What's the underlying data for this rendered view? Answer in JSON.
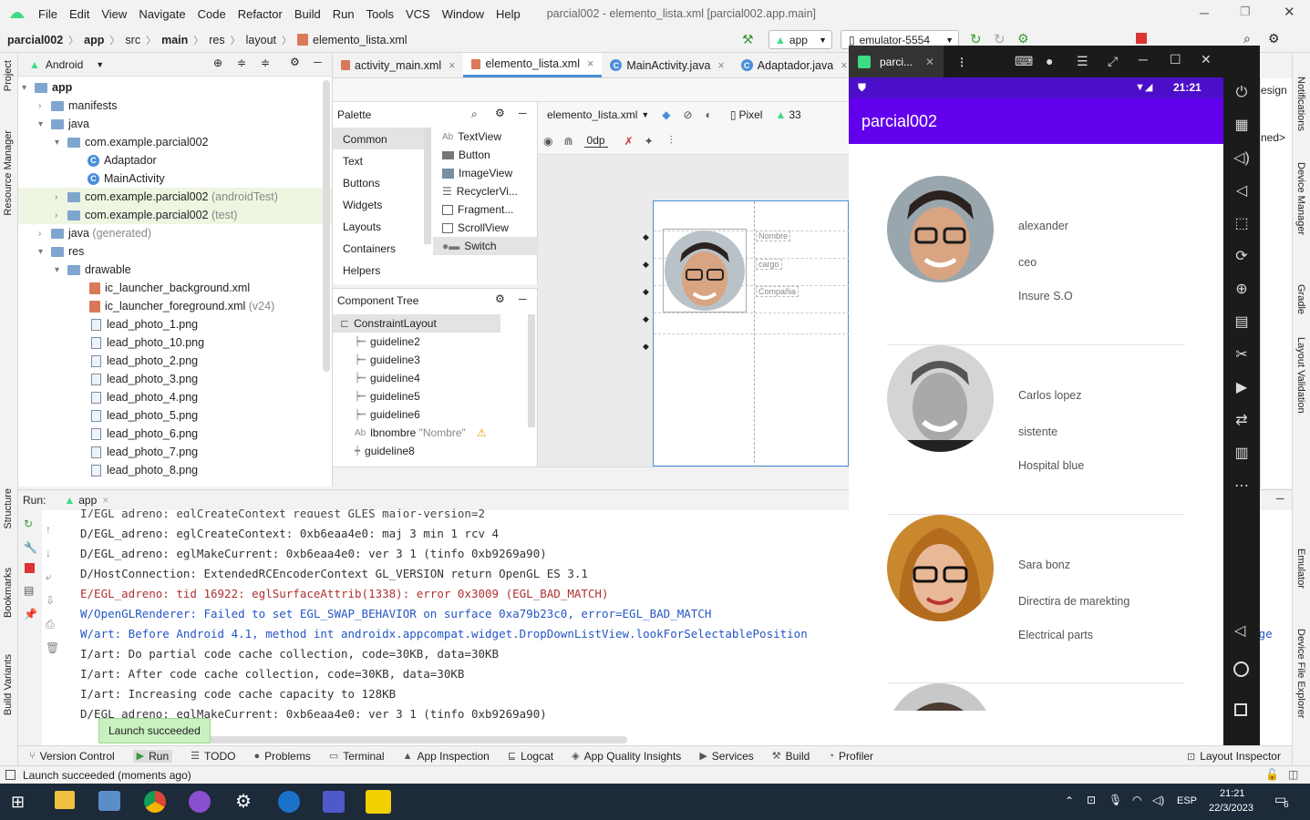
{
  "window": {
    "title": "parcial002 - elemento_lista.xml [parcial002.app.main]",
    "menu": [
      "File",
      "Edit",
      "View",
      "Navigate",
      "Code",
      "Refactor",
      "Build",
      "Run",
      "Tools",
      "VCS",
      "Window",
      "Help"
    ]
  },
  "breadcrumb": [
    "parcial002",
    "app",
    "src",
    "main",
    "res",
    "layout",
    "elemento_lista.xml"
  ],
  "toolbar": {
    "run_config": "app",
    "device": "emulator-5554"
  },
  "project": {
    "view": "Android",
    "items": [
      {
        "label": "app",
        "sub": ""
      },
      {
        "label": "manifests",
        "sub": ""
      },
      {
        "label": "java",
        "sub": ""
      },
      {
        "label": "com.example.parcial002",
        "sub": ""
      },
      {
        "label": "Adaptador",
        "sub": ""
      },
      {
        "label": "MainActivity",
        "sub": ""
      },
      {
        "label": "com.example.parcial002",
        "sub": "(androidTest)"
      },
      {
        "label": "com.example.parcial002",
        "sub": "(test)"
      },
      {
        "label": "java",
        "sub": "(generated)"
      },
      {
        "label": "res",
        "sub": ""
      },
      {
        "label": "drawable",
        "sub": ""
      },
      {
        "label": "ic_launcher_background.xml",
        "sub": ""
      },
      {
        "label": "ic_launcher_foreground.xml",
        "sub": "(v24)"
      },
      {
        "label": "lead_photo_1.png",
        "sub": ""
      },
      {
        "label": "lead_photo_10.png",
        "sub": ""
      },
      {
        "label": "lead_photo_2.png",
        "sub": ""
      },
      {
        "label": "lead_photo_3.png",
        "sub": ""
      },
      {
        "label": "lead_photo_4.png",
        "sub": ""
      },
      {
        "label": "lead_photo_5.png",
        "sub": ""
      },
      {
        "label": "lead_photo_6.png",
        "sub": ""
      },
      {
        "label": "lead_photo_7.png",
        "sub": ""
      },
      {
        "label": "lead_photo_8.png",
        "sub": ""
      }
    ]
  },
  "left_strip": [
    "Project",
    "Resource Manager",
    "Structure",
    "Bookmarks",
    "Build Variants"
  ],
  "right_strip": [
    "Notifications",
    "Device Manager",
    "Gradle",
    "Layout Validation",
    "Emulator",
    "Device File Explorer"
  ],
  "editor_tabs": [
    "activity_main.xml",
    "elemento_lista.xml",
    "MainActivity.java",
    "Adaptador.java"
  ],
  "palette": {
    "title": "Palette",
    "categories": [
      "Common",
      "Text",
      "Buttons",
      "Widgets",
      "Layouts",
      "Containers",
      "Helpers"
    ],
    "widgets": [
      "TextView",
      "Button",
      "ImageView",
      "RecyclerVi...",
      "Fragment...",
      "ScrollView",
      "Switch"
    ],
    "widget_prefix": "Ab"
  },
  "design_toolbar": {
    "file": "elemento_lista.xml",
    "device": "Pixel",
    "api": "33",
    "margin": "0dp"
  },
  "component_tree": {
    "title": "Component Tree",
    "items": [
      "ConstraintLayout",
      "guideline2",
      "guideline3",
      "guideline4",
      "guideline5",
      "guideline6",
      "lbnombre",
      "guideline8"
    ],
    "lbnombre_hint": "\"Nombre\""
  },
  "preview_labels": [
    "Nombre",
    "cargo",
    "Compañia"
  ],
  "run": {
    "label": "Run:",
    "config": "app",
    "log": [
      {
        "text": "D/EGL_adreno: eglCreateContext: 0xb6eaa4e0: maj 3 min 1 rcv 4",
        "level": "d"
      },
      {
        "text": "D/EGL_adreno: eglMakeCurrent: 0xb6eaa4e0: ver 3 1 (tinfo 0xb9269a90)",
        "level": "d"
      },
      {
        "text": "D/HostConnection: ExtendedRCEncoderContext GL_VERSION return OpenGL ES 3.1",
        "level": "d"
      },
      {
        "text": "E/EGL_adreno: tid 16922: eglSurfaceAttrib(1338): error 0x3009 (EGL_BAD_MATCH)",
        "level": "e"
      },
      {
        "text": "W/OpenGLRenderer: Failed to set EGL_SWAP_BEHAVIOR on surface 0xa79b23c0, error=EGL_BAD_MATCH",
        "level": "w"
      },
      {
        "text": "W/art: Before Android 4.1, method int androidx.appcompat.widget.DropDownListView.lookForSelectablePosition",
        "level": "w"
      },
      {
        "text": "I/art: Do partial code cache collection, code=30KB, data=30KB",
        "level": "i"
      },
      {
        "text": "I/art: After code cache collection, code=30KB, data=30KB",
        "level": "i"
      },
      {
        "text": "I/art: Increasing code cache capacity to 128KB",
        "level": "i"
      },
      {
        "text": "D/EGL_adreno: eglMakeCurrent: 0xb6eaa4e0: ver 3 1 (tinfo 0xb9269a90)",
        "level": "d"
      }
    ],
    "partial_top": "I/EGL_adreno: eglCreateContext request GLES major-version=2",
    "tail": "ckage",
    "toast": "Launch succeeded"
  },
  "bottom_tabs": [
    "Version Control",
    "Run",
    "TODO",
    "Problems",
    "Terminal",
    "App Inspection",
    "Logcat",
    "App Quality Insights",
    "Services",
    "Build",
    "Profiler"
  ],
  "layout_inspector": "Layout Inspector",
  "status": "Launch succeeded (moments ago)",
  "emulator": {
    "window_title": "parci...",
    "time": "21:21",
    "app_title": "parcial002",
    "contacts": [
      {
        "name": "alexander",
        "role": "ceo",
        "company": "Insure S.O"
      },
      {
        "name": "Carlos lopez",
        "role": "sistente",
        "company": "Hospital blue"
      },
      {
        "name": "Sara bonz",
        "role": "Directira de marekting",
        "company": "Electrical parts"
      }
    ]
  },
  "behind_emulator": {
    "design_tab": "esign",
    "text": "ned>"
  },
  "taskbar": {
    "time": "21:21",
    "date": "22/3/2023",
    "lang": "ESP",
    "notif": "6"
  }
}
